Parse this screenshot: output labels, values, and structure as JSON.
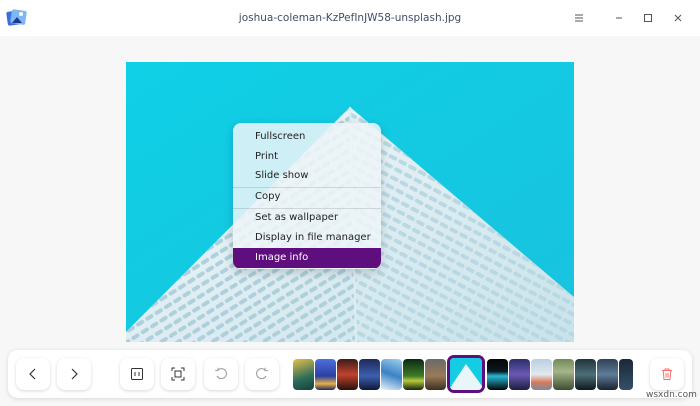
{
  "window": {
    "title": "joshua-coleman-KzPefInJW58-unsplash.jpg",
    "icons": [
      "app-icon",
      "menu-icon",
      "minimize-icon",
      "maximize-icon",
      "close-icon"
    ]
  },
  "context_menu": {
    "items": [
      {
        "label": "Fullscreen"
      },
      {
        "label": "Print"
      },
      {
        "label": "Slide show"
      },
      {
        "label": "Copy"
      },
      {
        "label": "Set as wallpaper"
      },
      {
        "label": "Display in file manager"
      },
      {
        "label": "Image info"
      }
    ],
    "highlighted": "Image info"
  },
  "toolbar": {
    "buttons": [
      "previous-icon",
      "next-icon",
      "original-size-icon",
      "fit-window-icon",
      "rotate-left-icon",
      "rotate-right-icon",
      "trash-icon"
    ],
    "thumbnail_count": 16,
    "selected_thumbnail": 8
  },
  "colors": {
    "accent": "#5e0f7d",
    "photo_sky": "#12c7df",
    "delete_icon": "#ff6b6b"
  },
  "watermark": "wsxdn.com"
}
